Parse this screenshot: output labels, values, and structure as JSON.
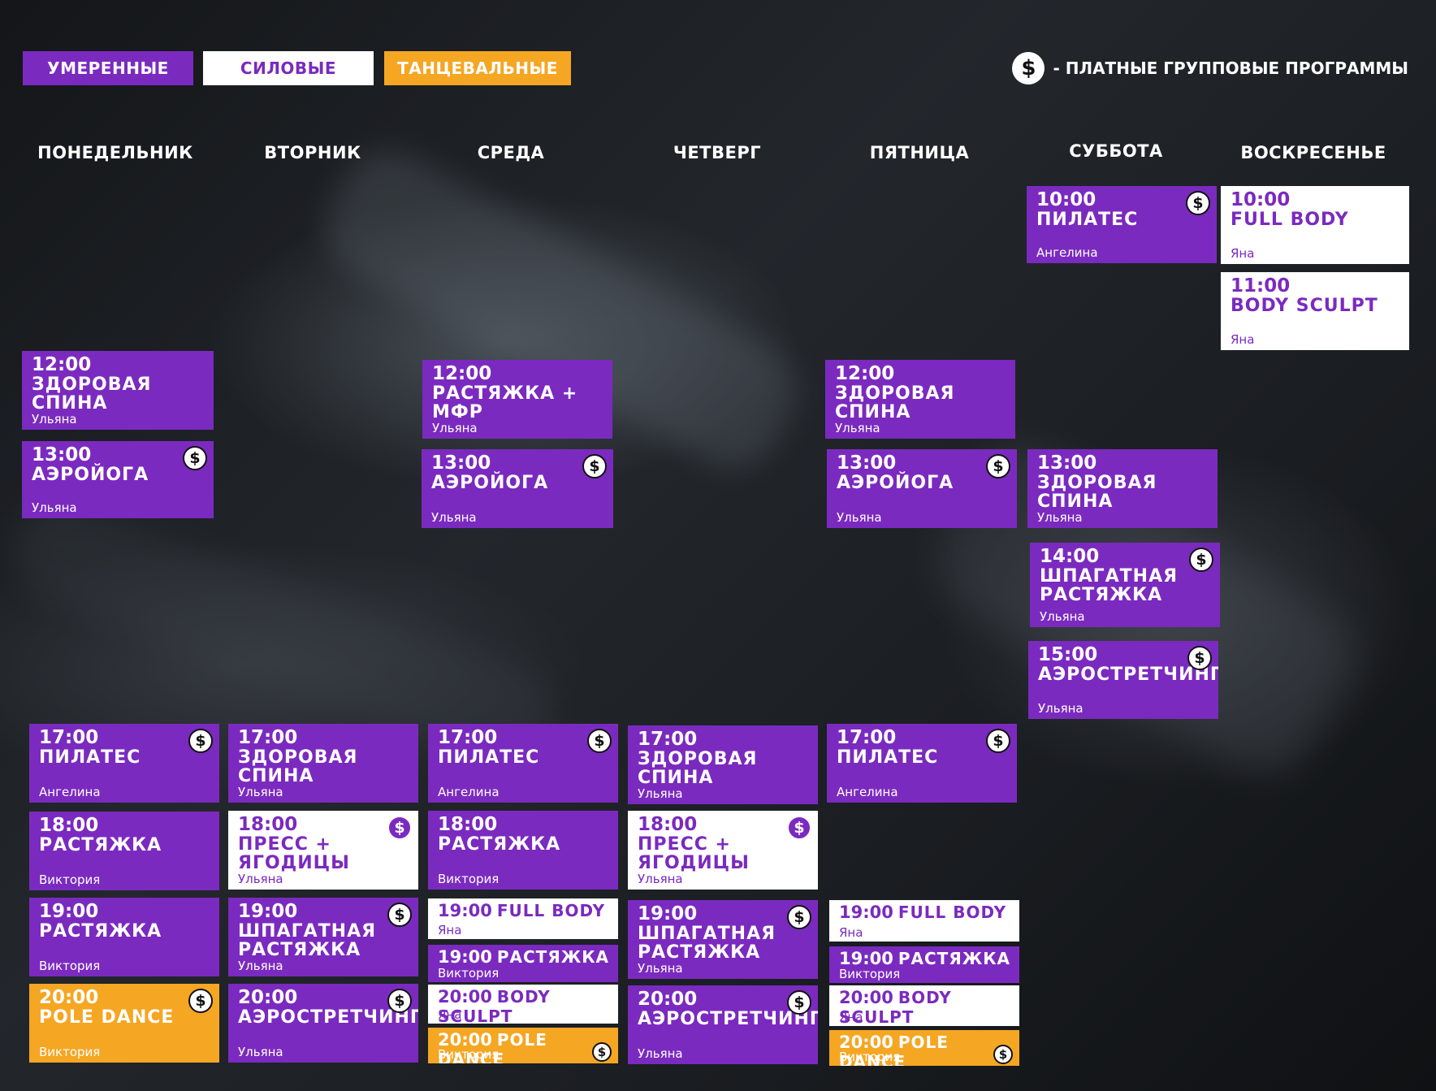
{
  "legend": {
    "moderate": "УМЕРЕННЫЕ",
    "strength": "СИЛОВЫЕ",
    "dance": "ТАНЦЕВАЛЬНЫЕ",
    "paid_symbol": "$",
    "paid_text": "- ПЛАТНЫЕ ГРУППОВЫЕ ПРОГРАММЫ"
  },
  "colors": {
    "moderate": "#7b2abf",
    "strength": "#ffffff",
    "dance": "#f5a623"
  },
  "days": [
    "ПОНЕДЕЛЬНИК",
    "ВТОРНИК",
    "СРЕДА",
    "ЧЕТВЕРГ",
    "ПЯТНИЦА",
    "СУББОТА",
    "ВОСКРЕСЕНЬЕ"
  ],
  "classes": [
    {
      "day": "ПОНЕДЕЛЬНИК",
      "time": "12:00",
      "title": "ЗДОРОВАЯ СПИНА",
      "coach": "Ульяна",
      "type": "moderate",
      "paid": false
    },
    {
      "day": "ПОНЕДЕЛЬНИК",
      "time": "13:00",
      "title": "АЭРОЙОГА",
      "coach": "Ульяна",
      "type": "moderate",
      "paid": true
    },
    {
      "day": "ПОНЕДЕЛЬНИК",
      "time": "17:00",
      "title": "ПИЛАТЕС",
      "coach": "Ангелина",
      "type": "moderate",
      "paid": true
    },
    {
      "day": "ПОНЕДЕЛЬНИК",
      "time": "18:00",
      "title": "РАСТЯЖКА",
      "coach": "Виктория",
      "type": "moderate",
      "paid": false
    },
    {
      "day": "ПОНЕДЕЛЬНИК",
      "time": "19:00",
      "title": "РАСТЯЖКА",
      "coach": "Виктория",
      "type": "moderate",
      "paid": false
    },
    {
      "day": "ПОНЕДЕЛЬНИК",
      "time": "20:00",
      "title": "POLE DANCE",
      "coach": "Виктория",
      "type": "dance",
      "paid": true
    },
    {
      "day": "ВТОРНИК",
      "time": "17:00",
      "title": "ЗДОРОВАЯ СПИНА",
      "coach": "Ульяна",
      "type": "moderate",
      "paid": false
    },
    {
      "day": "ВТОРНИК",
      "time": "18:00",
      "title": "ПРЕСС + ЯГОДИЦЫ",
      "coach": "Ульяна",
      "type": "strength",
      "paid": true
    },
    {
      "day": "ВТОРНИК",
      "time": "19:00",
      "title": "ШПАГАТНАЯ РАСТЯЖКА",
      "coach": "Ульяна",
      "type": "moderate",
      "paid": true
    },
    {
      "day": "ВТОРНИК",
      "time": "20:00",
      "title": "АЭРОСТРЕТЧИНГ",
      "coach": "Ульяна",
      "type": "moderate",
      "paid": true
    },
    {
      "day": "СРЕДА",
      "time": "12:00",
      "title": "РАСТЯЖКА + МФР",
      "coach": "Ульяна",
      "type": "moderate",
      "paid": false
    },
    {
      "day": "СРЕДА",
      "time": "13:00",
      "title": "АЭРОЙОГА",
      "coach": "Ульяна",
      "type": "moderate",
      "paid": true
    },
    {
      "day": "СРЕДА",
      "time": "17:00",
      "title": "ПИЛАТЕС",
      "coach": "Ангелина",
      "type": "moderate",
      "paid": true
    },
    {
      "day": "СРЕДА",
      "time": "18:00",
      "title": "РАСТЯЖКА",
      "coach": "Виктория",
      "type": "moderate",
      "paid": false
    },
    {
      "day": "СРЕДА",
      "time": "19:00",
      "title": "FULL BODY",
      "coach": "Яна",
      "type": "strength",
      "paid": false
    },
    {
      "day": "СРЕДА",
      "time": "19:00",
      "title": "РАСТЯЖКА",
      "coach": "Виктория",
      "type": "moderate",
      "paid": false
    },
    {
      "day": "СРЕДА",
      "time": "20:00",
      "title": "BODY SCULPT",
      "coach": "Яна",
      "type": "strength",
      "paid": false
    },
    {
      "day": "СРЕДА",
      "time": "20:00",
      "title": "POLE DANCE",
      "coach": "Виктория",
      "type": "dance",
      "paid": true
    },
    {
      "day": "ЧЕТВЕРГ",
      "time": "17:00",
      "title": "ЗДОРОВАЯ СПИНА",
      "coach": "Ульяна",
      "type": "moderate",
      "paid": false
    },
    {
      "day": "ЧЕТВЕРГ",
      "time": "18:00",
      "title": "ПРЕСС + ЯГОДИЦЫ",
      "coach": "Ульяна",
      "type": "strength",
      "paid": true
    },
    {
      "day": "ЧЕТВЕРГ",
      "time": "19:00",
      "title": "ШПАГАТНАЯ РАСТЯЖКА",
      "coach": "Ульяна",
      "type": "moderate",
      "paid": true
    },
    {
      "day": "ЧЕТВЕРГ",
      "time": "20:00",
      "title": "АЭРОСТРЕТЧИНГ",
      "coach": "Ульяна",
      "type": "moderate",
      "paid": true
    },
    {
      "day": "ПЯТНИЦА",
      "time": "12:00",
      "title": "ЗДОРОВАЯ СПИНА",
      "coach": "Ульяна",
      "type": "moderate",
      "paid": false
    },
    {
      "day": "ПЯТНИЦА",
      "time": "13:00",
      "title": "АЭРОЙОГА",
      "coach": "Ульяна",
      "type": "moderate",
      "paid": true
    },
    {
      "day": "ПЯТНИЦА",
      "time": "17:00",
      "title": "ПИЛАТЕС",
      "coach": "Ангелина",
      "type": "moderate",
      "paid": true
    },
    {
      "day": "ПЯТНИЦА",
      "time": "19:00",
      "title": "FULL BODY",
      "coach": "Яна",
      "type": "strength",
      "paid": false
    },
    {
      "day": "ПЯТНИЦА",
      "time": "19:00",
      "title": "РАСТЯЖКА",
      "coach": "Виктория",
      "type": "moderate",
      "paid": false
    },
    {
      "day": "ПЯТНИЦА",
      "time": "20:00",
      "title": "BODY SCULPT",
      "coach": "Яна",
      "type": "strength",
      "paid": false
    },
    {
      "day": "ПЯТНИЦА",
      "time": "20:00",
      "title": "POLE DANCE",
      "coach": "Виктория",
      "type": "dance",
      "paid": true
    },
    {
      "day": "СУББОТА",
      "time": "10:00",
      "title": "ПИЛАТЕС",
      "coach": "Ангелина",
      "type": "moderate",
      "paid": true
    },
    {
      "day": "СУББОТА",
      "time": "13:00",
      "title": "ЗДОРОВАЯ СПИНА",
      "coach": "Ульяна",
      "type": "moderate",
      "paid": false
    },
    {
      "day": "СУББОТА",
      "time": "14:00",
      "title": "ШПАГАТНАЯ РАСТЯЖКА",
      "coach": "Ульяна",
      "type": "moderate",
      "paid": true
    },
    {
      "day": "СУББОТА",
      "time": "15:00",
      "title": "АЭРОСТРЕТЧИНГ",
      "coach": "Ульяна",
      "type": "moderate",
      "paid": true
    },
    {
      "day": "ВОСКРЕСЕНЬЕ",
      "time": "10:00",
      "title": "FULL BODY",
      "coach": "Яна",
      "type": "strength",
      "paid": false
    },
    {
      "day": "ВОСКРЕСЕНЬЕ",
      "time": "11:00",
      "title": "BODY SCULPT",
      "coach": "Яна",
      "type": "strength",
      "paid": false
    }
  ]
}
